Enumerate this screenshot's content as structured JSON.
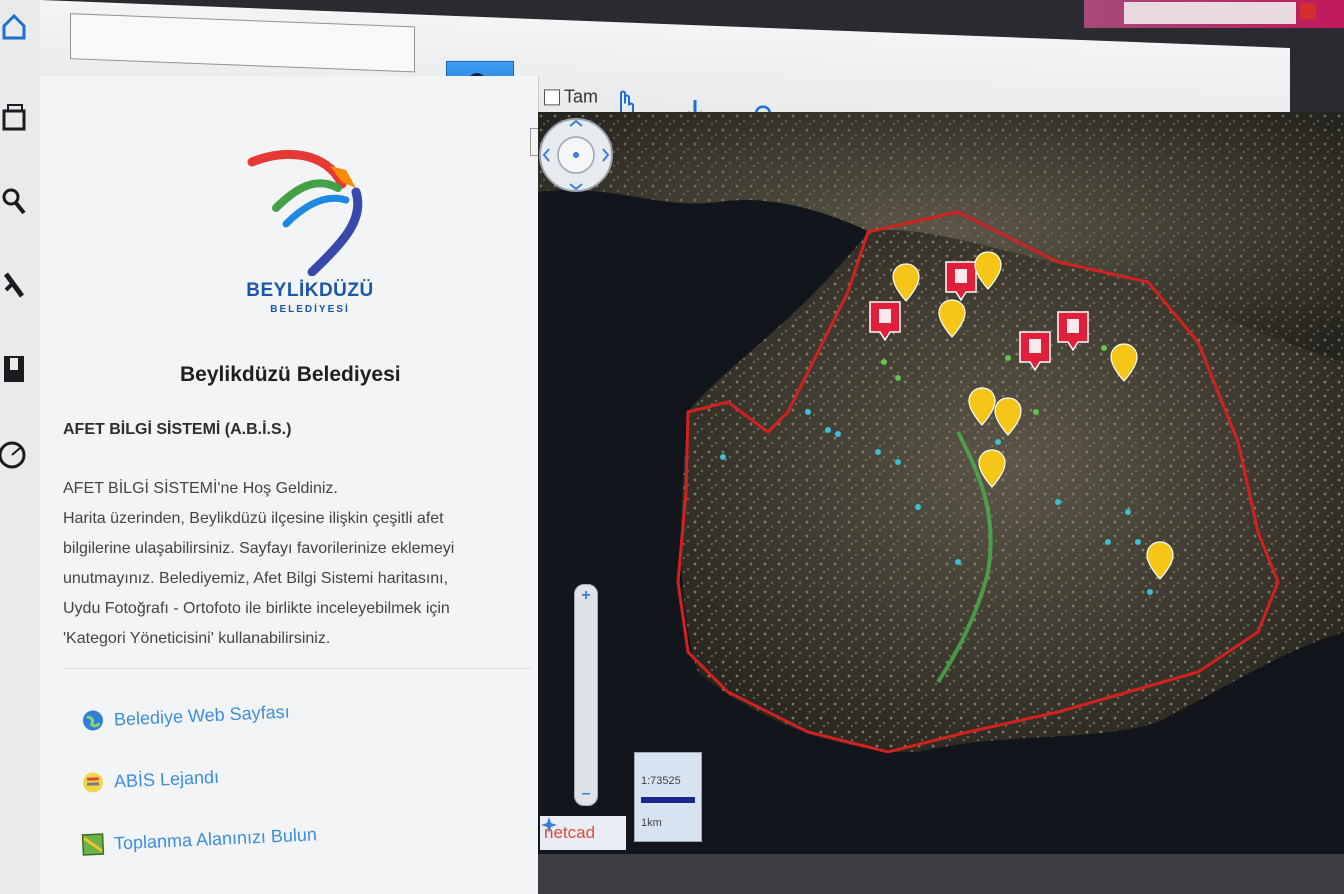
{
  "toolbar": {
    "search_placeholder": "",
    "search_icon": "search-icon",
    "full_label": "Tam",
    "tools": [
      "hand-pan-icon",
      "download-marker-icon",
      "marker-icon",
      "info-icon",
      "pointer-select-icon",
      "print-icon",
      "globe-icon",
      "save-icon",
      "help-icon",
      "settings-icon"
    ]
  },
  "left_strip": {
    "icons": [
      "home-icon",
      "layers-icon",
      "magnifier-icon",
      "draw-tool-icon",
      "book-icon",
      "clock-icon"
    ]
  },
  "info_panel": {
    "logo_text": "BEYLİKDÜZÜ",
    "logo_sub": "BELEDİYESİ",
    "title": "Beylikdüzü Belediyesi",
    "section_title": "AFET BİLGİ SİSTEMİ (A.B.İ.S.)",
    "welcome_lines": [
      "AFET BİLGİ SİSTEMİ'ne Hoş Geldiniz.",
      "Harita üzerinden, Beylikdüzü ilçesine ilişkin çeşitli afet",
      "bilgilerine ulaşabilirsiniz. Sayfayı favorilerinize eklemeyi",
      "unutmayınız. Belediyemiz, Afet Bilgi Sistemi haritasını,",
      "Uydu Fotoğrafı - Ortofoto ile birlikte inceleyebilmek için",
      "'Kategori Yöneticisini' kullanabilirsiniz."
    ],
    "links": [
      {
        "label": "Belediye Web Sayfası",
        "icon": "globe-icon"
      },
      {
        "label": "ABİS Lejandı",
        "icon": "legend-icon"
      },
      {
        "label": "Toplanma Alanınızı Bulun",
        "icon": "map-icon"
      }
    ]
  },
  "map": {
    "scale_value": "1:73525",
    "scale_unit": "1km",
    "brand": "netcad",
    "colors": {
      "boundary": "#d32020",
      "marker_yellow": "#f5c518",
      "marker_red": "#e0203a",
      "water": "#12151b",
      "land": "#3f3a30"
    }
  }
}
